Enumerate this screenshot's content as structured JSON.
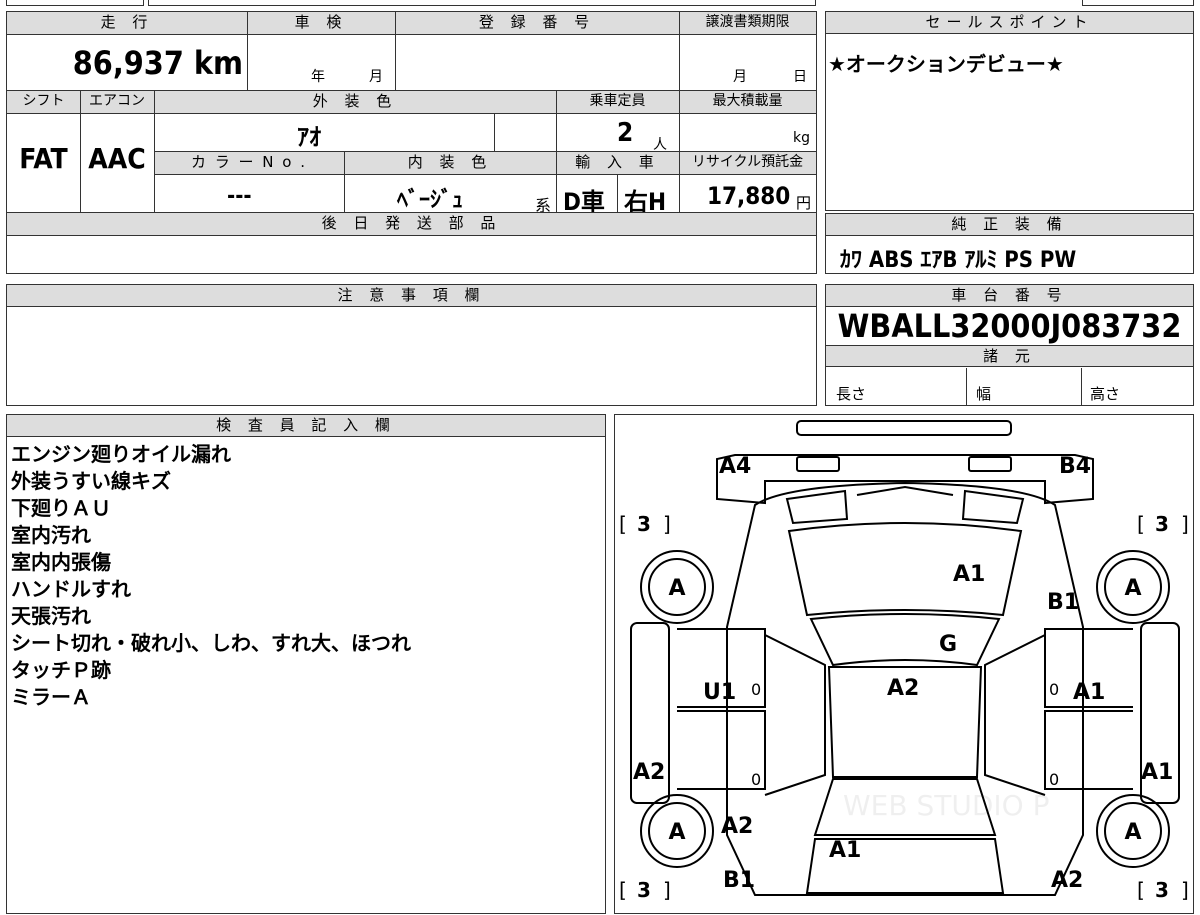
{
  "top": {
    "left_value": "",
    "mid_value": ""
  },
  "vehicle": {
    "mileage_label": "走 行",
    "mileage_value": "86,937",
    "mileage_unit": "km",
    "inspection_label": "車 検",
    "inspection_year": "年",
    "inspection_month": "月",
    "registration_label": "登 録 番 号",
    "transfer_label": "譲渡書類期限",
    "transfer_month": "月",
    "transfer_day": "日",
    "shift_label": "シフト",
    "shift_value": "FAT",
    "ac_label": "エアコン",
    "ac_value": "AAC",
    "exterior_label": "外 装 色",
    "exterior_value": "ｱｵ",
    "capacity_label": "乗車定員",
    "capacity_value": "2",
    "capacity_unit": "人",
    "maxload_label": "最大積載量",
    "maxload_unit": "kg",
    "color_no_label": "カ ラ ー N o .",
    "color_no_value": "---",
    "interior_label": "内 装 色",
    "interior_value": "ﾍﾞｰｼﾞｭ",
    "interior_suffix": "系",
    "import_label": "輸 入 車",
    "import_value": "D車",
    "steering_value": "右H",
    "recycle_label": "リサイクル預託金",
    "recycle_value": "17,880",
    "recycle_unit": "円",
    "later_parts_label": "後 日 発 送 部 品"
  },
  "sales_point": {
    "label": "セールスポイント",
    "text": "★オークションデビュー★"
  },
  "equipment": {
    "label": "純 正 装 備",
    "text": "ｶﾜ ABS ｴｱB ｱﾙﾐ PS PW"
  },
  "caution": {
    "label": "注 意 事 項 欄"
  },
  "chassis": {
    "label": "車 台 番 号",
    "value": "WBALL32000J083732"
  },
  "specs": {
    "label": "諸 元",
    "length": "長さ",
    "width": "幅",
    "height": "高さ"
  },
  "inspector": {
    "label": "検 査 員 記 入 欄",
    "notes": [
      "エンジン廻りオイル漏れ",
      "外装うすい線キズ",
      "下廻りＡＵ",
      "室内汚れ",
      "室内内張傷",
      "ハンドルすれ",
      "天張汚れ",
      "シート切れ・破れ小、しわ、すれ大、ほつれ",
      "タッチＰ跡",
      "ミラーＡ"
    ]
  },
  "diagram": {
    "marks": {
      "front_left": "A4",
      "front_right": "B4",
      "hood": "A1",
      "right_front_fender": "B1",
      "windshield": "G",
      "roof": "A2",
      "left_front_door": "U1",
      "right_front_door": "A1",
      "left_rocker": "A2",
      "right_rocker": "A1",
      "left_rear_fender": "A2",
      "trunk": "A1",
      "rear_left": "B1",
      "rear_right": "A2"
    },
    "tires": {
      "fl": "A",
      "fr": "A",
      "rl": "A",
      "rr": "A"
    },
    "tread": {
      "fl": "3",
      "fr": "3",
      "rl": "3",
      "rr": "3"
    },
    "zeros": [
      "0",
      "0",
      "0",
      "0"
    ],
    "watermark": "WEB STUDIO P"
  }
}
